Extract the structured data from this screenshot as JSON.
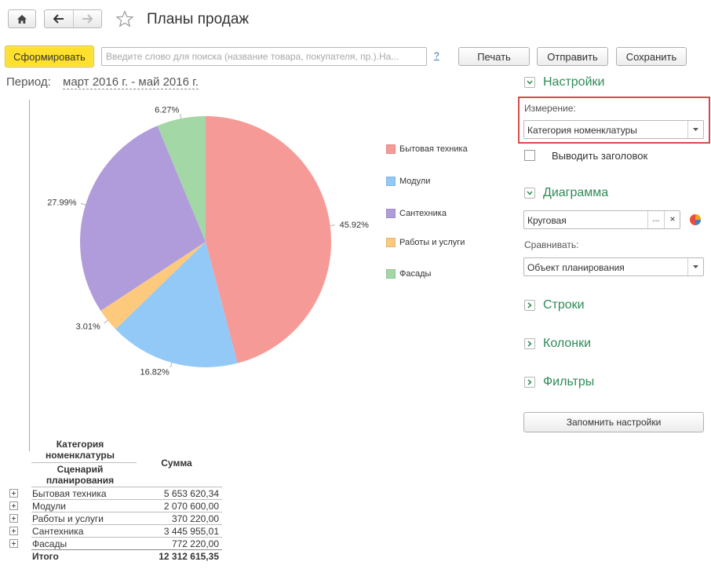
{
  "header": {
    "title": "Планы продаж"
  },
  "toolbar": {
    "generate_label": "Сформировать",
    "search_placeholder": "Введите слово для поиска (название товара, покупателя, пр.).На...",
    "help_label": "?",
    "print_label": "Печать",
    "send_label": "Отправить",
    "save_label": "Сохранить"
  },
  "period": {
    "label": "Период:",
    "value": "март 2016 г. - май 2016 г."
  },
  "chart_data": {
    "type": "pie",
    "categories": [
      "Бытовая техника",
      "Модули",
      "Сантехника",
      "Работы и услуги",
      "Фасады"
    ],
    "values": [
      45.92,
      16.82,
      27.99,
      3.01,
      6.27
    ],
    "slice_order": [
      "Бытовая техника",
      "Модули",
      "Работы и услуги",
      "Сантехника",
      "Фасады"
    ],
    "labels": {
      "Бытовая техника": "45.92%",
      "Модули": "16.82%",
      "Сантехника": "27.99%",
      "Работы и услуги": "3.01%",
      "Фасады": "6.27%"
    },
    "colors": {
      "Бытовая техника": "#f59a96",
      "Модули": "#93c9f7",
      "Сантехника": "#b09cdb",
      "Работы и услуги": "#fdc97d",
      "Фасады": "#a3d7a5"
    },
    "legend": [
      "Бытовая техника",
      "Модули",
      "Сантехника",
      "Работы и услуги",
      "Фасады"
    ],
    "legend_position": "right"
  },
  "table": {
    "header_category": "Категория номенклатуры",
    "header_scenario": "Сценарий планирования",
    "header_sum": "Сумма",
    "rows": [
      {
        "name": "Бытовая техника",
        "value": "5 653 620,34"
      },
      {
        "name": "Модули",
        "value": "2 070 600,00"
      },
      {
        "name": "Работы и услуги",
        "value": "370 220,00"
      },
      {
        "name": "Сантехника",
        "value": "3 445 955,01"
      },
      {
        "name": "Фасады",
        "value": "772 220,00"
      }
    ],
    "total_label": "Итого",
    "total_value": "12 312 615,35"
  },
  "settings": {
    "section_settings": "Настройки",
    "dimension_label": "Измерение:",
    "dimension_value": "Категория номенклатуры",
    "show_header_label": "Выводить заголовок",
    "section_chart": "Диаграмма",
    "chart_type_value": "Круговая",
    "chart_type_dots": "...",
    "chart_type_clear": "×",
    "compare_label": "Сравнивать:",
    "compare_value": "Объект планирования",
    "section_rows": "Строки",
    "section_columns": "Колонки",
    "section_filters": "Фильтры",
    "remember_label": "Запомнить настройки"
  }
}
